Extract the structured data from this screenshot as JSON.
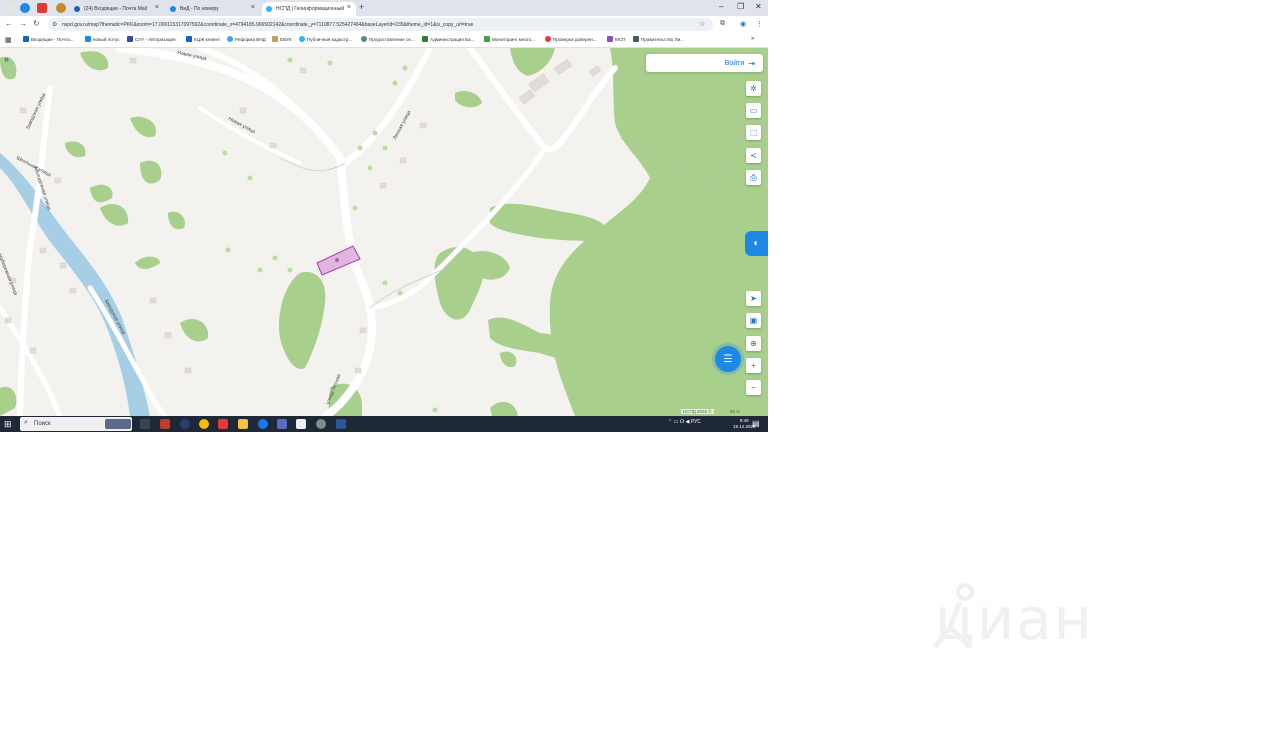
{
  "browser": {
    "tabs": [
      {
        "label": "(24) Входящие - Почта Mail",
        "active": false
      },
      {
        "label": "ВиД - По номеру",
        "active": false
      },
      {
        "label": "НСПД | Геоинформационный",
        "active": true
      }
    ],
    "url": "nspd.gov.ru/map?thematic=PKK&zoom=17.000115317097592&coordinate_x=4794185.966502142&coordinate_y=7110877.525427464&baseLayerId=235&theme_id=1&is_copy_url=true",
    "bookmarks": [
      "Входящие - Почта...",
      "новый лотус",
      "СУУ - Авторизация",
      "КЦЖ клиент",
      "Реформа ВНД",
      "ЕВУК",
      "Публичная кадастр...",
      "Предоставление се...",
      "Администрация Ба...",
      "Мониторинг много...",
      "Проверка доверен...",
      "МСП",
      "Правительство Ли..."
    ],
    "bookmarks_more": "»"
  },
  "map": {
    "login_label": "Войти",
    "attribution": "НСПД 2025 ©",
    "scale": "50 m",
    "streets": [
      "Новая улица",
      "Новая улица",
      "Лесная улица",
      "Заводская улица",
      "Школьная улица",
      "Молодёжная улица",
      "Заводская улица",
      "Набережная улица",
      "улица Лесная"
    ],
    "colors": {
      "forest": "#a8cf8c",
      "road": "#ffffff",
      "parcel": "#d9a6d9",
      "accent": "#1e88e5"
    }
  },
  "taskbar": {
    "search_placeholder": "Поиск",
    "language": "РУС",
    "time": "9:49",
    "date": "19.12.2025"
  },
  "watermark": "циан"
}
